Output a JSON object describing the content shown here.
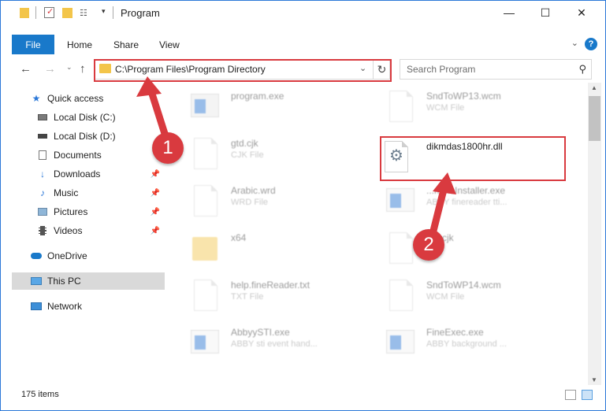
{
  "window": {
    "title": "Program",
    "controls": {
      "minimize": "—",
      "maximize": "☐",
      "close": "✕"
    }
  },
  "ribbon": {
    "tabs": [
      "File",
      "Home",
      "Share",
      "View"
    ],
    "help": "?"
  },
  "address": {
    "path": "C:\\Program Files\\Program Directory",
    "search_placeholder": "Search Program"
  },
  "sidebar": {
    "items": [
      {
        "label": "Quick access",
        "icon": "star-icon",
        "pinned": false
      },
      {
        "label": "Local Disk (C:)",
        "icon": "drive-icon",
        "pinned": false
      },
      {
        "label": "Local Disk (D:)",
        "icon": "drive-icon",
        "pinned": false
      },
      {
        "label": "Documents",
        "icon": "documents-icon",
        "pinned": false
      },
      {
        "label": "Downloads",
        "icon": "download-icon",
        "pinned": true
      },
      {
        "label": "Music",
        "icon": "music-icon",
        "pinned": true
      },
      {
        "label": "Pictures",
        "icon": "pictures-icon",
        "pinned": true
      },
      {
        "label": "Videos",
        "icon": "video-icon",
        "pinned": true
      },
      {
        "label": "OneDrive",
        "icon": "cloud-icon",
        "pinned": false
      },
      {
        "label": "This PC",
        "icon": "computer-icon",
        "pinned": false,
        "selected": true
      },
      {
        "label": "Network",
        "icon": "network-icon",
        "pinned": false
      }
    ]
  },
  "files": {
    "left": [
      {
        "name": "program.exe",
        "type": "",
        "icon": "setup-icon"
      },
      {
        "name": "gtd.cjk",
        "type": "CJK File",
        "icon": "document-icon"
      },
      {
        "name": "Arabic.wrd",
        "type": "WRD File",
        "icon": "document-icon"
      },
      {
        "name": "x64",
        "type": "",
        "icon": "folder-icon"
      },
      {
        "name": "help.fineReader.txt",
        "type": "TXT File",
        "icon": "document-icon"
      },
      {
        "name": "AbbyySTI.exe",
        "type": "ABBY sti event hand...",
        "icon": "application-icon"
      }
    ],
    "right": [
      {
        "name": "SndToWP13.wcm",
        "type": "WCM File",
        "icon": "document-icon",
        "faded": true
      },
      {
        "name": "dikmdas1800hr.dll",
        "type": "",
        "icon": "dll-gears-icon",
        "faded": false
      },
      {
        "name": "...mmsInstaller.exe",
        "type": "ABBY finereader tti...",
        "icon": "application-icon",
        "faded": true
      },
      {
        "name": "...n.cjk",
        "type": "...",
        "icon": "document-icon",
        "faded": true
      },
      {
        "name": "SndToWP14.wcm",
        "type": "WCM File",
        "icon": "document-icon",
        "faded": true
      },
      {
        "name": "FineExec.exe",
        "type": "ABBY background ...",
        "icon": "application-icon",
        "faded": true
      }
    ]
  },
  "status": {
    "item_count": "175 items"
  },
  "annotations": {
    "step1": "1",
    "step2": "2",
    "color": "#d93a3f"
  }
}
